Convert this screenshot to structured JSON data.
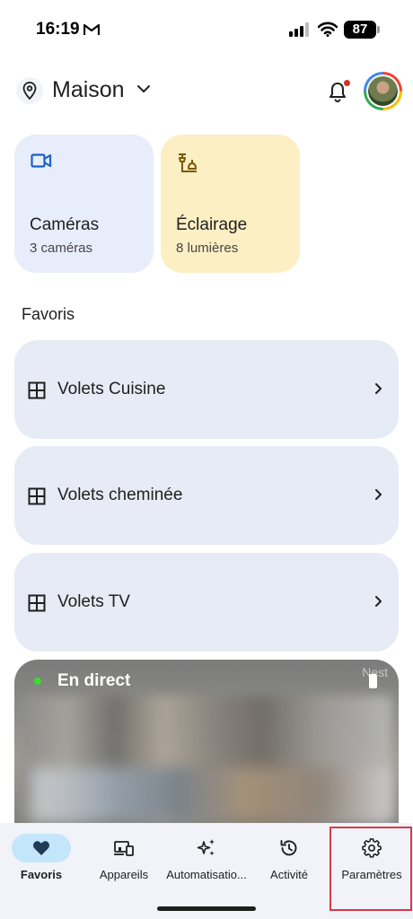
{
  "status_bar": {
    "time": "16:19",
    "battery": "87"
  },
  "header": {
    "home_name": "Maison"
  },
  "tiles": [
    {
      "title": "Caméras",
      "subtitle": "3 caméras",
      "icon": "video-camera-icon",
      "color": "#e8edfb"
    },
    {
      "title": "Éclairage",
      "subtitle": "8 lumières",
      "icon": "lamp-icon",
      "color": "#fdefc4"
    }
  ],
  "favorites": {
    "title": "Favoris",
    "items": [
      {
        "label": "Volets Cuisine",
        "icon": "window-blinds-icon"
      },
      {
        "label": "Volets cheminée",
        "icon": "window-blinds-icon"
      },
      {
        "label": "Volets TV",
        "icon": "window-blinds-icon"
      }
    ]
  },
  "live": {
    "label": "En direct",
    "brand": "Nest"
  },
  "nav": {
    "items": [
      {
        "label": "Favoris",
        "icon": "heart-icon",
        "active": true
      },
      {
        "label": "Appareils",
        "icon": "devices-icon",
        "active": false
      },
      {
        "label": "Automatisatio...",
        "icon": "sparkle-icon",
        "active": false
      },
      {
        "label": "Activité",
        "icon": "history-icon",
        "active": false
      },
      {
        "label": "Paramètres",
        "icon": "gear-icon",
        "active": false
      }
    ]
  },
  "colors": {
    "accent_pill": "#c4e6fb",
    "highlight_box": "#d93848",
    "live_dot": "#3ddc2a",
    "notification_dot": "#d93025"
  }
}
